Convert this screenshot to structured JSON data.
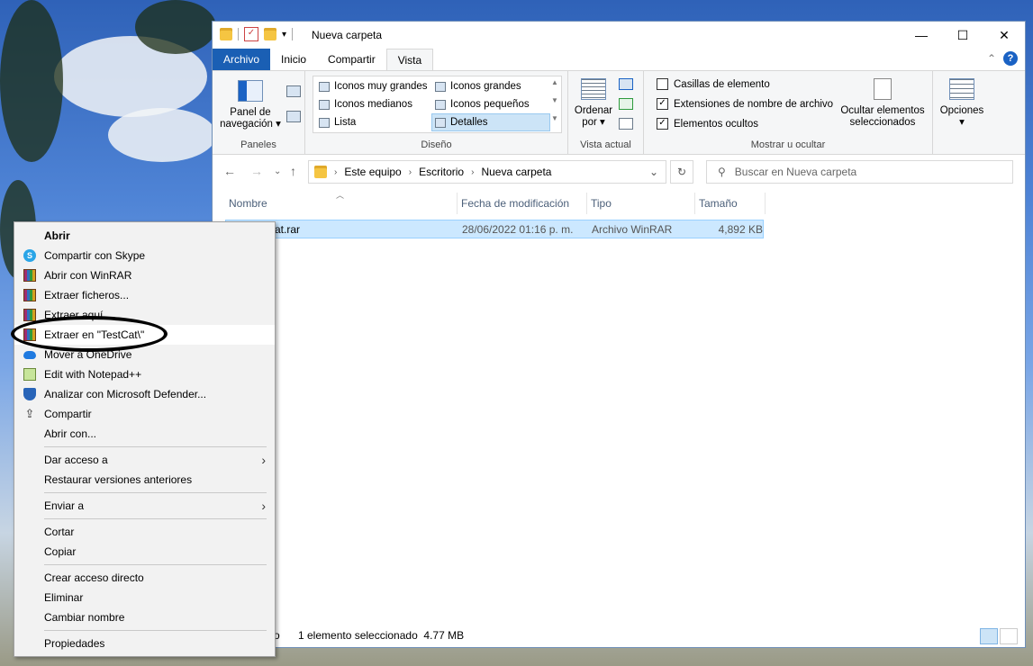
{
  "window": {
    "title": "Nueva carpeta",
    "controls": {
      "minimize": "—",
      "maximize": "☐",
      "close": "✕"
    }
  },
  "ribbon": {
    "tabs": [
      {
        "label": "Archivo"
      },
      {
        "label": "Inicio"
      },
      {
        "label": "Compartir"
      },
      {
        "label": "Vista"
      }
    ],
    "panes": {
      "nav_label_1": "Panel de",
      "nav_label_2": "navegación ▾",
      "caption": "Paneles"
    },
    "layout": {
      "items": [
        "Iconos muy grandes",
        "Iconos grandes",
        "Iconos medianos",
        "Iconos pequeños",
        "Lista",
        "Detalles"
      ],
      "caption": "Diseño"
    },
    "current_view": {
      "sort_label_1": "Ordenar",
      "sort_label_2": "por ▾",
      "caption": "Vista actual"
    },
    "show_hide": {
      "checkboxes": [
        {
          "label": "Casillas de elemento",
          "checked": false
        },
        {
          "label": "Extensiones de nombre de archivo",
          "checked": true
        },
        {
          "label": "Elementos ocultos",
          "checked": true
        }
      ],
      "hide_label_1": "Ocultar elementos",
      "hide_label_2": "seleccionados",
      "caption": "Mostrar u ocultar"
    },
    "options": {
      "label": "Opciones",
      "sub": "▾"
    },
    "help": "?"
  },
  "address": {
    "crumbs": [
      "Este equipo",
      "Escritorio",
      "Nueva carpeta"
    ],
    "search_placeholder": "Buscar en Nueva carpeta"
  },
  "columns": [
    "Nombre",
    "Fecha de modificación",
    "Tipo",
    "Tamaño"
  ],
  "files": [
    {
      "name": "TestCat.rar",
      "visible_name": "at.rar",
      "date": "28/06/2022 01:16 p. m.",
      "type": "Archivo WinRAR",
      "size": "4,892 KB"
    }
  ],
  "status": {
    "text": "1 elemento seleccionado  4.77 MB",
    "count_fragment": "o"
  },
  "context_menu": {
    "items": {
      "abrir": "Abrir",
      "skype": "Compartir con Skype",
      "abrir_winrar": "Abrir con WinRAR",
      "extraer_ficheros": "Extraer ficheros...",
      "extraer_aqui": "Extraer aquí",
      "extraer_en": "Extraer en \"TestCat\\\"",
      "onedrive": "Mover a OneDrive",
      "notepad": "Edit with Notepad++",
      "defender": "Analizar con Microsoft Defender...",
      "compartir": "Compartir",
      "abrir_con": "Abrir con...",
      "dar_acceso": "Dar acceso a",
      "restaurar": "Restaurar versiones anteriores",
      "enviar_a": "Enviar a",
      "cortar": "Cortar",
      "copiar": "Copiar",
      "crear_acceso": "Crear acceso directo",
      "eliminar": "Eliminar",
      "cambiar_nombre": "Cambiar nombre",
      "propiedades": "Propiedades"
    },
    "submenu_arrow": "›"
  },
  "colors": {
    "file_tab": "#1a5fb4",
    "selection": "#cce8ff",
    "menu_bg": "#f2f2f2"
  }
}
